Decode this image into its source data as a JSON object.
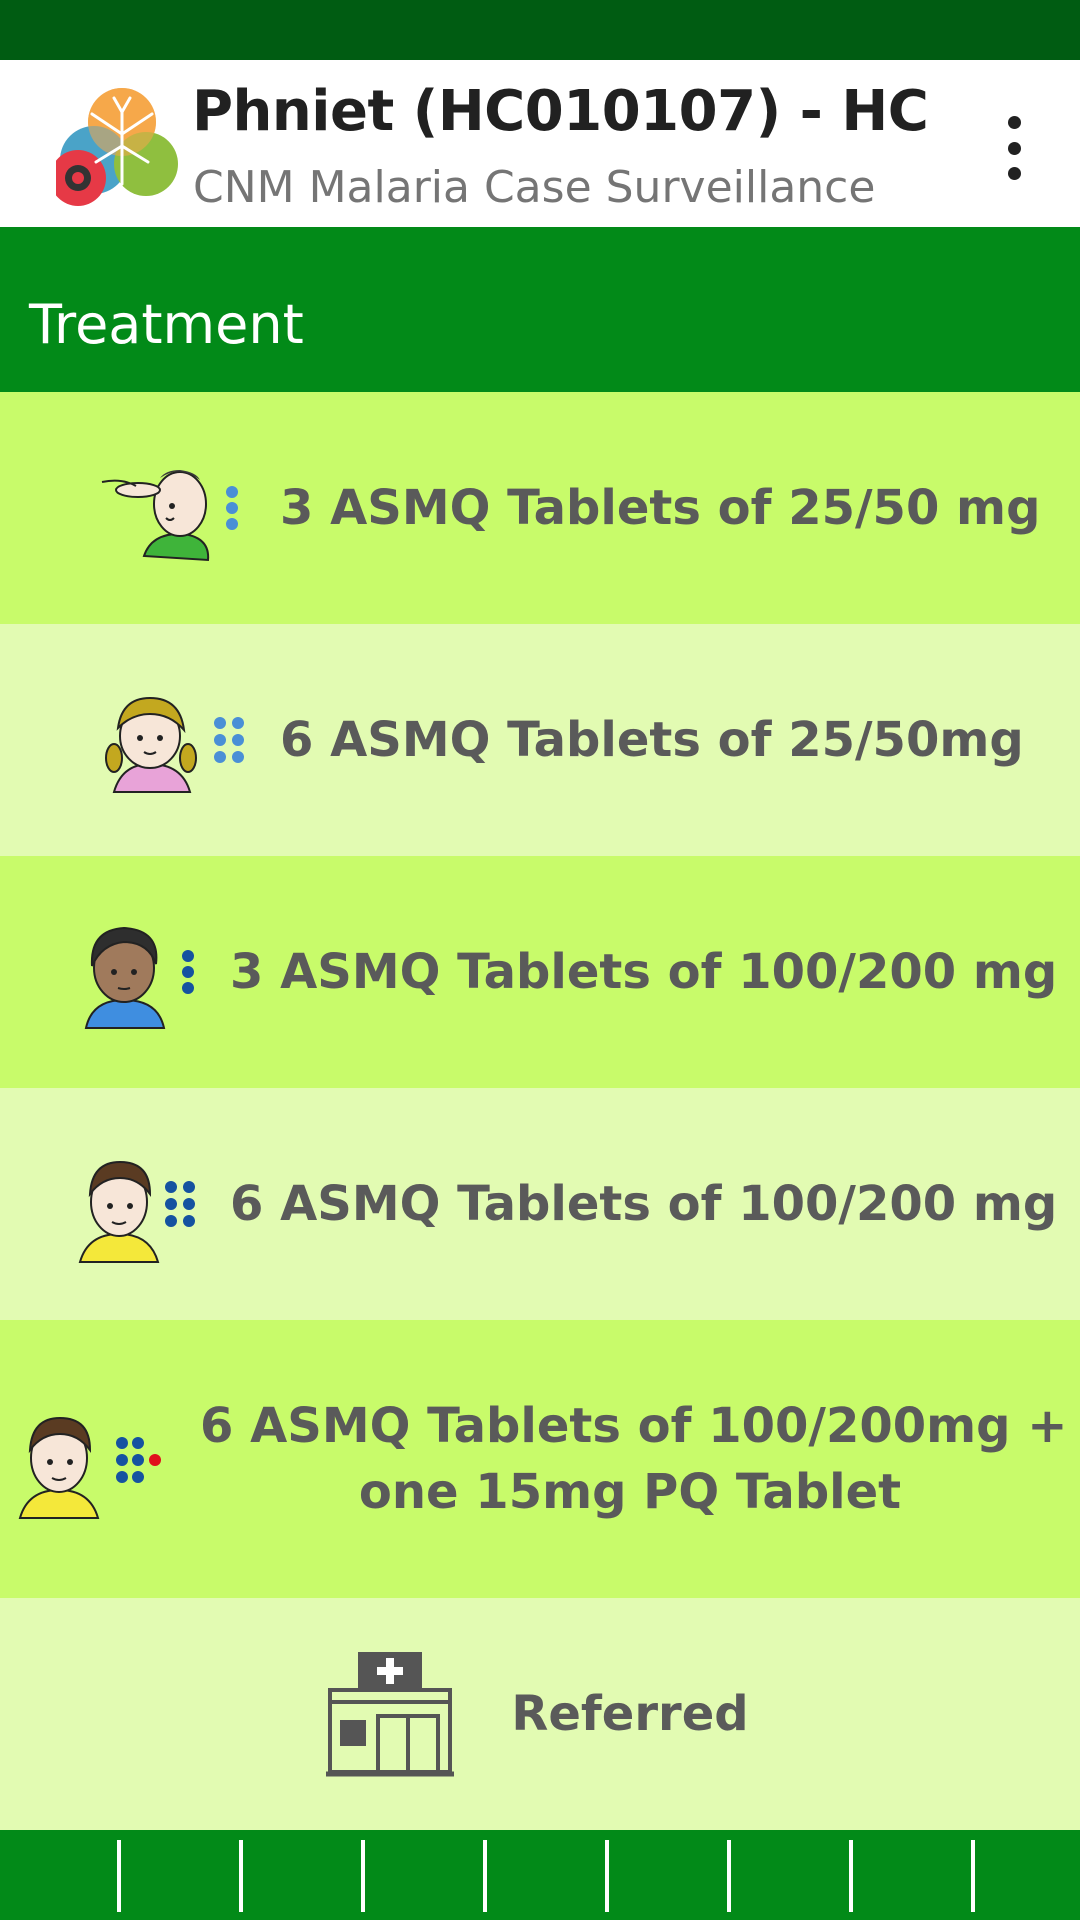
{
  "app": {
    "title": "Phniet (HC010107) - HC",
    "subtitle": "CNM Malaria Case Surveillance"
  },
  "section": {
    "title": "Treatment"
  },
  "options": [
    {
      "label": "3 ASMQ Tablets of 25/50 mg",
      "icon": "infant-icon",
      "dots_icon": "three-dots-icon"
    },
    {
      "label": "6 ASMQ Tablets of 25/50mg",
      "icon": "toddler-girl-icon",
      "dots_icon": "six-dots-icon"
    },
    {
      "label": "3 ASMQ Tablets of 100/200 mg",
      "icon": "child-icon",
      "dots_icon": "three-dots-icon"
    },
    {
      "label": "6 ASMQ Tablets of 100/200 mg",
      "icon": "older-child-icon",
      "dots_icon": "six-dots-icon"
    },
    {
      "label_line1": "6 ASMQ Tablets of 100/200mg +",
      "label_line2": "one 15mg PQ Tablet",
      "icon": "adult-icon",
      "dots_icon": "six-dots-plus-red-icon"
    },
    {
      "label": "Referred",
      "icon": "health-center-icon"
    }
  ],
  "colors": {
    "status_bar": "#005c12",
    "primary_green": "#028a18",
    "row_dark": "#c8fb6a",
    "row_light": "#e2fbb2",
    "label_text": "#5a5a5a",
    "dot_blue_light": "#4a8fd6",
    "dot_blue_dark": "#1552a0",
    "dot_red": "#e0101c"
  }
}
